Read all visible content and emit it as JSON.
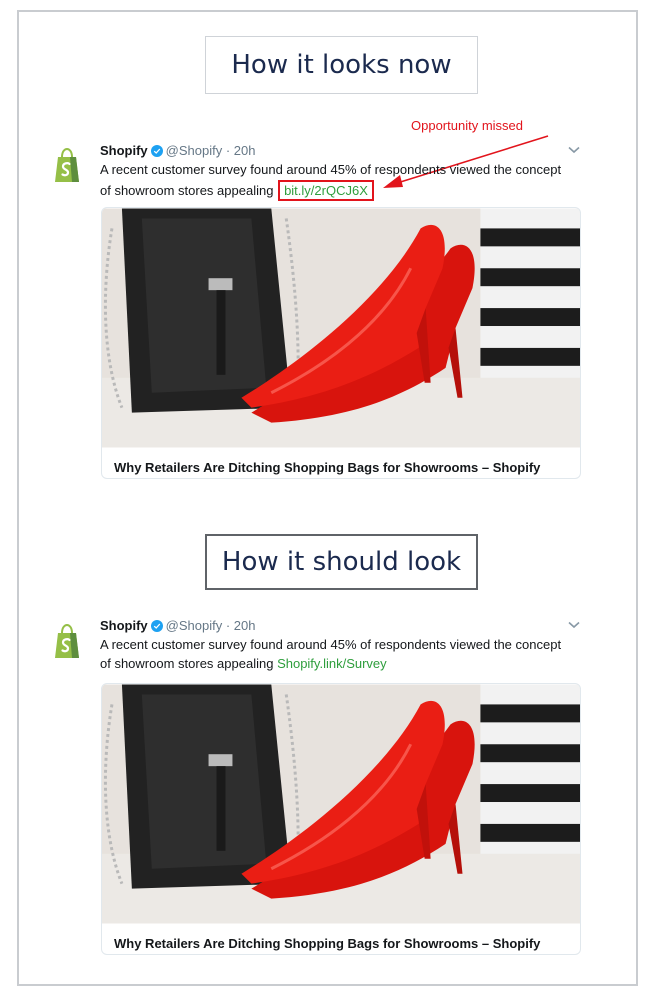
{
  "sections": {
    "before": {
      "heading": "How it looks now"
    },
    "after": {
      "heading": "How it should look"
    }
  },
  "annotation": {
    "text": "Opportunity missed",
    "color": "#e2141c"
  },
  "tweet_before": {
    "account_name": "Shopify",
    "handle_time": "@Shopify · 20h",
    "text_line1": "A recent customer survey found around 45% of respondents viewed the concept",
    "text_line2_prefix": "of showroom stores appealing",
    "link": "bit.ly/2rQCJ6X",
    "card_title": "Why Retailers Are Ditching Shopping Bags for Showrooms – Shopify"
  },
  "tweet_after": {
    "account_name": "Shopify",
    "handle_time": "@Shopify · 20h",
    "text_line1": "A recent customer survey found around 45% of respondents viewed the concept",
    "text_line2_prefix": "of showroom stores appealing",
    "link": "Shopify.link/Survey",
    "card_title": "Why Retailers Are Ditching Shopping Bags for Showrooms – Shopify"
  },
  "colors": {
    "link": "#2f9e3d",
    "shopify_green": "#95bf47",
    "verified_blue": "#1da1f2",
    "heading_text": "#1b2a4e",
    "highlight_red": "#e2141c"
  },
  "icons": [
    "shopify-bag-icon",
    "verified-badge-icon",
    "chevron-down-icon",
    "annotation-arrow-icon"
  ]
}
